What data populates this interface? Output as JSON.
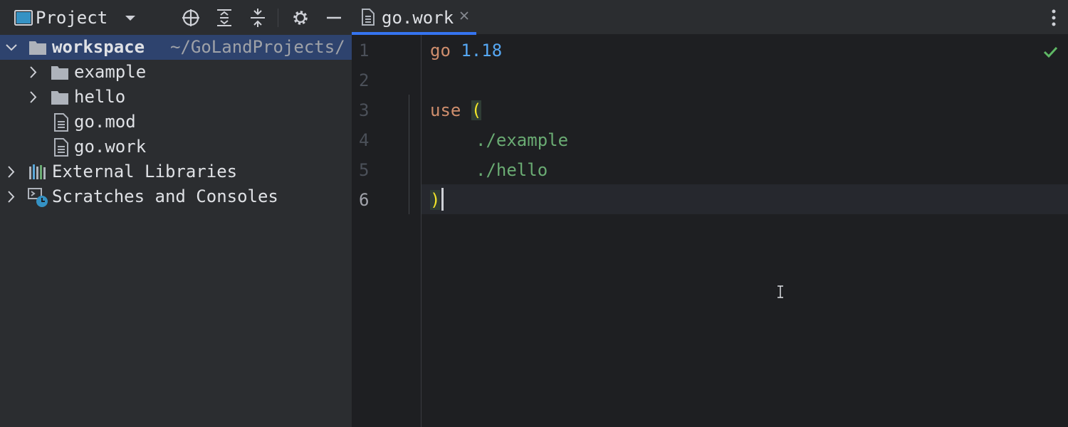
{
  "project_panel": {
    "title": "Project",
    "tree": [
      {
        "label": "workspace",
        "path": "~/GoLandProjects/",
        "type": "folder",
        "expanded": true,
        "selected": true
      },
      {
        "label": "example",
        "type": "folder",
        "expanded": false
      },
      {
        "label": "hello",
        "type": "folder",
        "expanded": false
      },
      {
        "label": "go.mod",
        "type": "file"
      },
      {
        "label": "go.work",
        "type": "file"
      },
      {
        "label": "External Libraries",
        "type": "libraries",
        "expanded": false
      },
      {
        "label": "Scratches and Consoles",
        "type": "scratches",
        "expanded": false
      }
    ],
    "toolbar_icons": [
      "crosshair-icon",
      "expand-all-icon",
      "collapse-all-icon",
      "gear-icon",
      "minimize-icon"
    ]
  },
  "editor": {
    "tab": {
      "label": "go.work",
      "active": true
    },
    "line_numbers": [
      "1",
      "2",
      "3",
      "4",
      "5",
      "6"
    ],
    "current_line": "6",
    "code": {
      "line1_keyword": "go",
      "line1_version": "1.18",
      "line3_keyword": "use",
      "line3_paren": "(",
      "line4_path": "./example",
      "line5_path": "./hello",
      "line6_paren": ")"
    },
    "status_icon": "check-icon"
  },
  "colors": {
    "accent": "#3574f0",
    "keyword": "#cf8e6d",
    "number": "#56a8f5",
    "string": "#6aab73",
    "brace_match": "#f2e629",
    "check": "#5fb865"
  }
}
